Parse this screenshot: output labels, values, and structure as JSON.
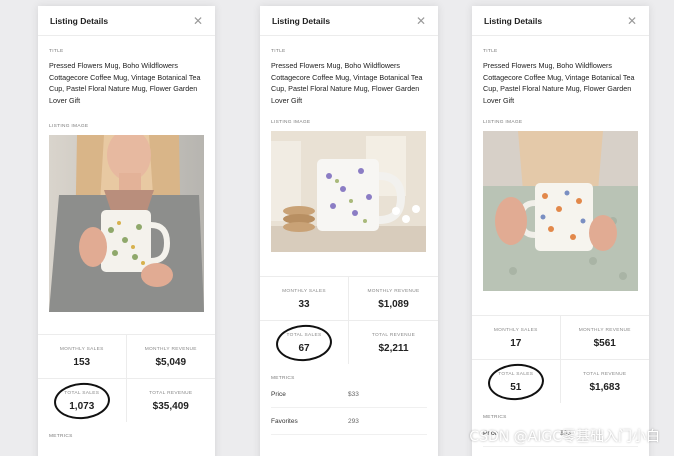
{
  "panels": [
    {
      "header": {
        "title": "Listing Details"
      },
      "title_label": "TITLE",
      "title_text": "Pressed Flowers Mug, Boho Wildflowers Cottagecore Coffee Mug, Vintage Botanical Tea Cup, Pastel Floral Nature Mug, Flower Garden Lover Gift",
      "image_label": "LISTING IMAGE",
      "stats": [
        {
          "label": "MONTHLY SALES",
          "value": "153"
        },
        {
          "label": "MONTHLY REVENUE",
          "value": "$5,049"
        },
        {
          "label": "TOTAL SALES",
          "value": "1,073"
        },
        {
          "label": "TOTAL REVENUE",
          "value": "$35,409"
        }
      ],
      "metrics_label": "METRICS"
    },
    {
      "header": {
        "title": "Listing Details"
      },
      "title_label": "TITLE",
      "title_text": "Pressed Flowers Mug, Boho Wildflowers Cottagecore Coffee Mug, Vintage Botanical Tea Cup, Pastel Floral Nature Mug, Flower Garden Lover Gift",
      "image_label": "LISTING IMAGE",
      "stats": [
        {
          "label": "MONTHLY SALES",
          "value": "33"
        },
        {
          "label": "MONTHLY REVENUE",
          "value": "$1,089"
        },
        {
          "label": "TOTAL SALES",
          "value": "67"
        },
        {
          "label": "TOTAL REVENUE",
          "value": "$2,211"
        }
      ],
      "metrics_label": "METRICS",
      "metrics": [
        {
          "name": "Price",
          "value": "$33"
        },
        {
          "name": "Favorites",
          "value": "293"
        }
      ]
    },
    {
      "header": {
        "title": "Listing Details"
      },
      "title_label": "TITLE",
      "title_text": "Pressed Flowers Mug, Boho Wildflowers Cottagecore Coffee Mug, Vintage Botanical Tea Cup, Pastel Floral Nature Mug, Flower Garden Lover Gift",
      "image_label": "LISTING IMAGE",
      "stats": [
        {
          "label": "MONTHLY SALES",
          "value": "17"
        },
        {
          "label": "MONTHLY REVENUE",
          "value": "$561"
        },
        {
          "label": "TOTAL SALES",
          "value": "51"
        },
        {
          "label": "TOTAL REVENUE",
          "value": "$1,683"
        }
      ],
      "metrics_label": "METRICS",
      "metrics": [
        {
          "name": "Price",
          "value": "$33"
        }
      ]
    }
  ],
  "watermark": "CSDN @AIGC零基础入门小白",
  "icons": {
    "close": "close-icon"
  },
  "colors": {
    "background": "#ececee",
    "panel": "#ffffff",
    "text": "#222222",
    "circle": "#111111"
  }
}
